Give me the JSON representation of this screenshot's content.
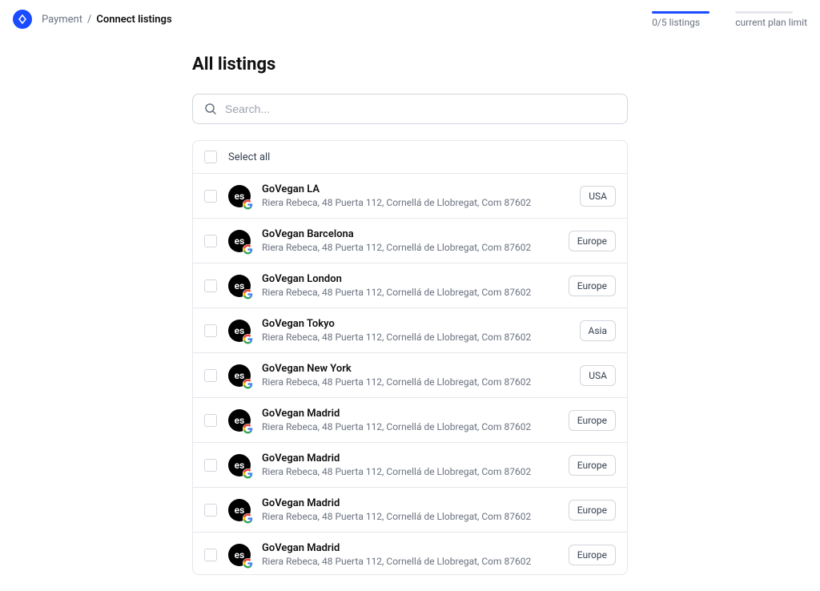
{
  "breadcrumb": {
    "parent": "Payment",
    "current": "Connect listings"
  },
  "progress": {
    "listings_label": "0/5 listings",
    "plan_label": "current plan limit"
  },
  "page": {
    "title": "All listings"
  },
  "search": {
    "placeholder": "Search..."
  },
  "select_all": {
    "label": "Select all"
  },
  "listings": [
    {
      "name": "GoVegan LA",
      "address": "Riera Rebeca, 48 Puerta 112, Cornellá de Llobregat, Com 87602",
      "region": "USA"
    },
    {
      "name": "GoVegan Barcelona",
      "address": "Riera Rebeca, 48 Puerta 112, Cornellá de Llobregat, Com 87602",
      "region": "Europe"
    },
    {
      "name": "GoVegan London",
      "address": "Riera Rebeca, 48 Puerta 112, Cornellá de Llobregat, Com 87602",
      "region": "Europe"
    },
    {
      "name": "GoVegan Tokyo",
      "address": "Riera Rebeca, 48 Puerta 112, Cornellá de Llobregat, Com 87602",
      "region": "Asia"
    },
    {
      "name": "GoVegan New York",
      "address": "Riera Rebeca, 48 Puerta 112, Cornellá de Llobregat, Com 87602",
      "region": "USA"
    },
    {
      "name": "GoVegan Madrid",
      "address": "Riera Rebeca, 48 Puerta 112, Cornellá de Llobregat, Com 87602",
      "region": "Europe"
    },
    {
      "name": "GoVegan Madrid",
      "address": "Riera Rebeca, 48 Puerta 112, Cornellá de Llobregat, Com 87602",
      "region": "Europe"
    },
    {
      "name": "GoVegan Madrid",
      "address": "Riera Rebeca, 48 Puerta 112, Cornellá de Llobregat, Com 87602",
      "region": "Europe"
    },
    {
      "name": "GoVegan Madrid",
      "address": "Riera Rebeca, 48 Puerta 112, Cornellá de Llobregat, Com 87602",
      "region": "Europe"
    }
  ],
  "icon_text": "es"
}
